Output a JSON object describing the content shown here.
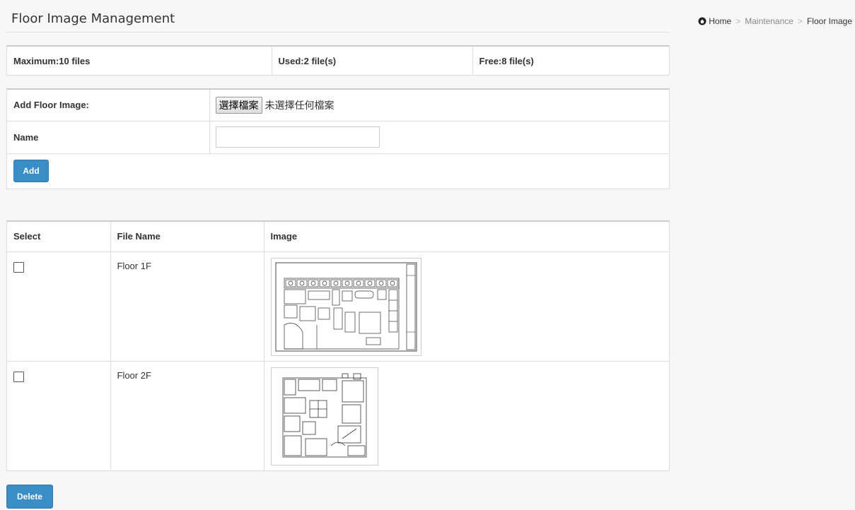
{
  "header": {
    "title": "Floor Image Management",
    "breadcrumb": {
      "home": "Home",
      "section": "Maintenance",
      "current": "Floor Image",
      "separator": ">"
    }
  },
  "stats": {
    "maximum": "Maximum:10 files",
    "used": "Used:2 file(s)",
    "free": "Free:8 file(s)"
  },
  "form": {
    "add_label": "Add Floor Image:",
    "file_button": "選擇檔案",
    "file_status": "未選擇任何檔案",
    "name_label": "Name",
    "name_value": "",
    "add_button": "Add"
  },
  "files": {
    "columns": [
      "Select",
      "File Name",
      "Image"
    ],
    "rows": [
      {
        "name": "Floor 1F",
        "checked": false,
        "image_icon": "floor-plan-1f"
      },
      {
        "name": "Floor 2F",
        "checked": false,
        "image_icon": "floor-plan-2f"
      }
    ]
  },
  "delete_button": "Delete",
  "colors": {
    "accent": "#3a8ec8",
    "border": "#dddddd",
    "background": "#f7f7f7"
  }
}
